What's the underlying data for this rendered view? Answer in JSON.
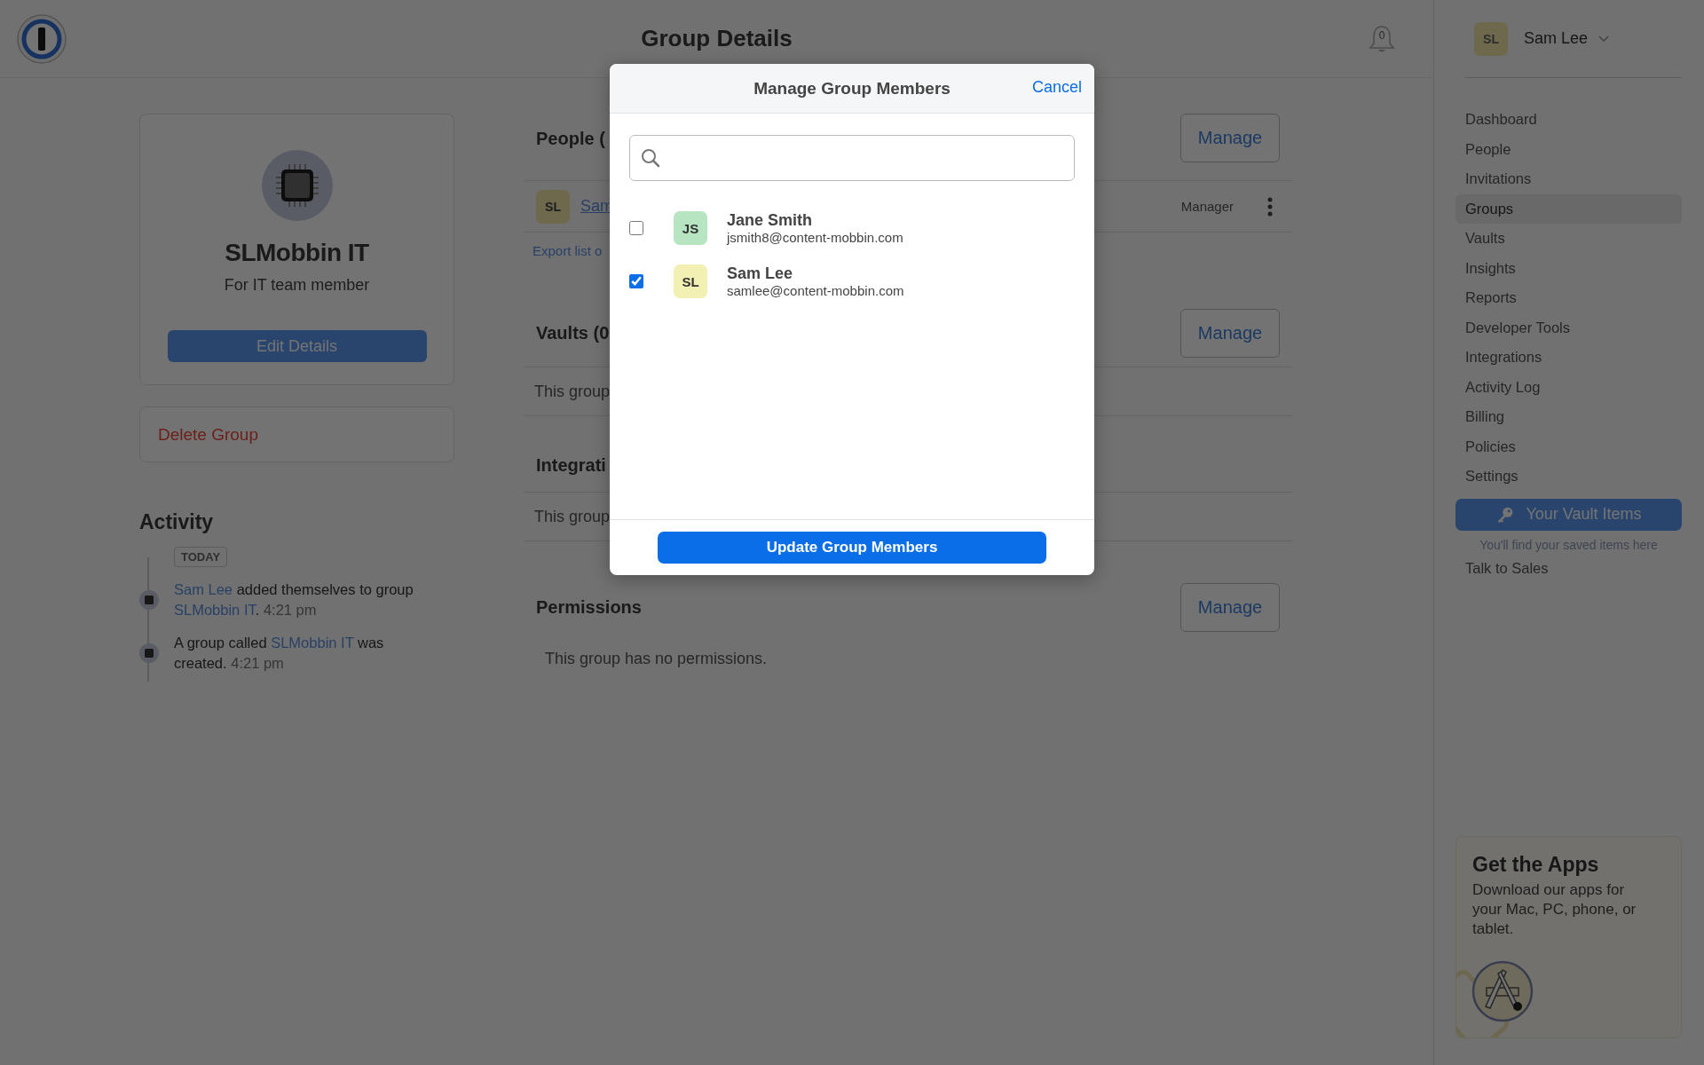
{
  "header": {
    "title": "Group Details",
    "notification_count": "0"
  },
  "group": {
    "name": "SLMobbin IT",
    "description": "For IT team member",
    "edit_button": "Edit Details",
    "delete_button": "Delete Group"
  },
  "activity": {
    "title": "Activity",
    "date_label": "TODAY",
    "events": [
      {
        "parts": [
          {
            "kind": "link",
            "text": "Sam Lee"
          },
          {
            "kind": "text",
            "text": " added themselves to group "
          },
          {
            "kind": "link",
            "text": "SLMobbin IT"
          },
          {
            "kind": "text",
            "text": "."
          }
        ],
        "time": "4:21 pm"
      },
      {
        "parts": [
          {
            "kind": "text",
            "text": "A group called "
          },
          {
            "kind": "link",
            "text": "SLMobbin IT"
          },
          {
            "kind": "text",
            "text": " was created."
          }
        ],
        "time": "4:21 pm"
      }
    ]
  },
  "sections": [
    {
      "title": "People (",
      "manage": "Manage",
      "members": [
        {
          "initials": "SL",
          "name": "Sam",
          "role": "Manager"
        }
      ],
      "export_link": "Export list o"
    },
    {
      "title": "Vaults (0",
      "manage": "Manage",
      "empty": "This group"
    },
    {
      "title": "Integrati",
      "empty": "This group"
    },
    {
      "title": "Permissions",
      "manage": "Manage",
      "empty": "This group has no permissions."
    }
  ],
  "sidebar": {
    "user": {
      "initials": "SL",
      "name": "Sam Lee"
    },
    "items": [
      {
        "label": "Dashboard",
        "selected": false
      },
      {
        "label": "People",
        "selected": false
      },
      {
        "label": "Invitations",
        "selected": false
      },
      {
        "label": "Groups",
        "selected": true
      },
      {
        "label": "Vaults",
        "selected": false
      },
      {
        "label": "Insights",
        "selected": false
      },
      {
        "label": "Reports",
        "selected": false
      },
      {
        "label": "Developer Tools",
        "selected": false
      },
      {
        "label": "Integrations",
        "selected": false
      },
      {
        "label": "Activity Log",
        "selected": false
      },
      {
        "label": "Billing",
        "selected": false
      },
      {
        "label": "Policies",
        "selected": false
      },
      {
        "label": "Settings",
        "selected": false
      }
    ],
    "vault_button": "Your Vault Items",
    "vault_hint": "You'll find your saved items here",
    "talk_to_sales": "Talk to Sales",
    "apps_card": {
      "title": "Get the Apps",
      "body": "Download our apps for your Mac, PC, phone, or tablet."
    }
  },
  "modal": {
    "title": "Manage Group Members",
    "cancel": "Cancel",
    "members": [
      {
        "initials": "JS",
        "name": "Jane Smith",
        "email": "jsmith8@content-mobbin.com",
        "checked": false,
        "color": "#b7e4c1"
      },
      {
        "initials": "SL",
        "name": "Sam Lee",
        "email": "samlee@content-mobbin.com",
        "checked": true,
        "color": "#f3f0b4"
      }
    ],
    "submit": "Update Group Members"
  }
}
